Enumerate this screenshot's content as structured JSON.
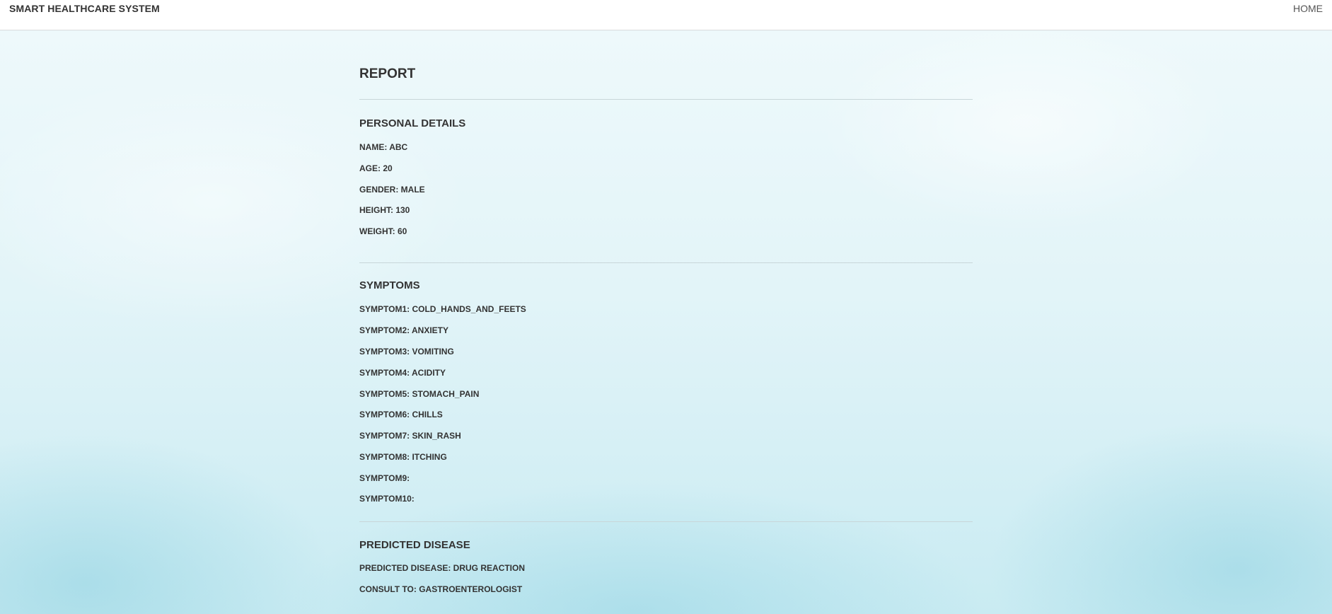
{
  "navbar": {
    "brand": "SMART HEALTHCARE SYSTEM",
    "home_label": "HOME"
  },
  "report": {
    "title": "REPORT"
  },
  "personal": {
    "title": "PERSONAL DETAILS",
    "name": "NAME: ABC",
    "age": "AGE: 20",
    "gender": "GENDER: MALE",
    "height": "HEIGHT: 130",
    "weight": "WEIGHT: 60"
  },
  "symptoms": {
    "title": "SYMPTOMS",
    "items": [
      "SYMPTOM1: COLD_HANDS_AND_FEETS",
      "SYMPTOM2: ANXIETY",
      "SYMPTOM3: VOMITING",
      "SYMPTOM4: ACIDITY",
      "SYMPTOM5: STOMACH_PAIN",
      "SYMPTOM6: CHILLS",
      "SYMPTOM7: SKIN_RASH",
      "SYMPTOM8: ITCHING",
      "SYMPTOM9:",
      "SYMPTOM10:"
    ]
  },
  "prediction": {
    "title": "PREDICTED DISEASE",
    "disease": "PREDICTED DISEASE: DRUG REACTION",
    "consult": "CONSULT TO: GASTROENTEROLOGIST"
  }
}
